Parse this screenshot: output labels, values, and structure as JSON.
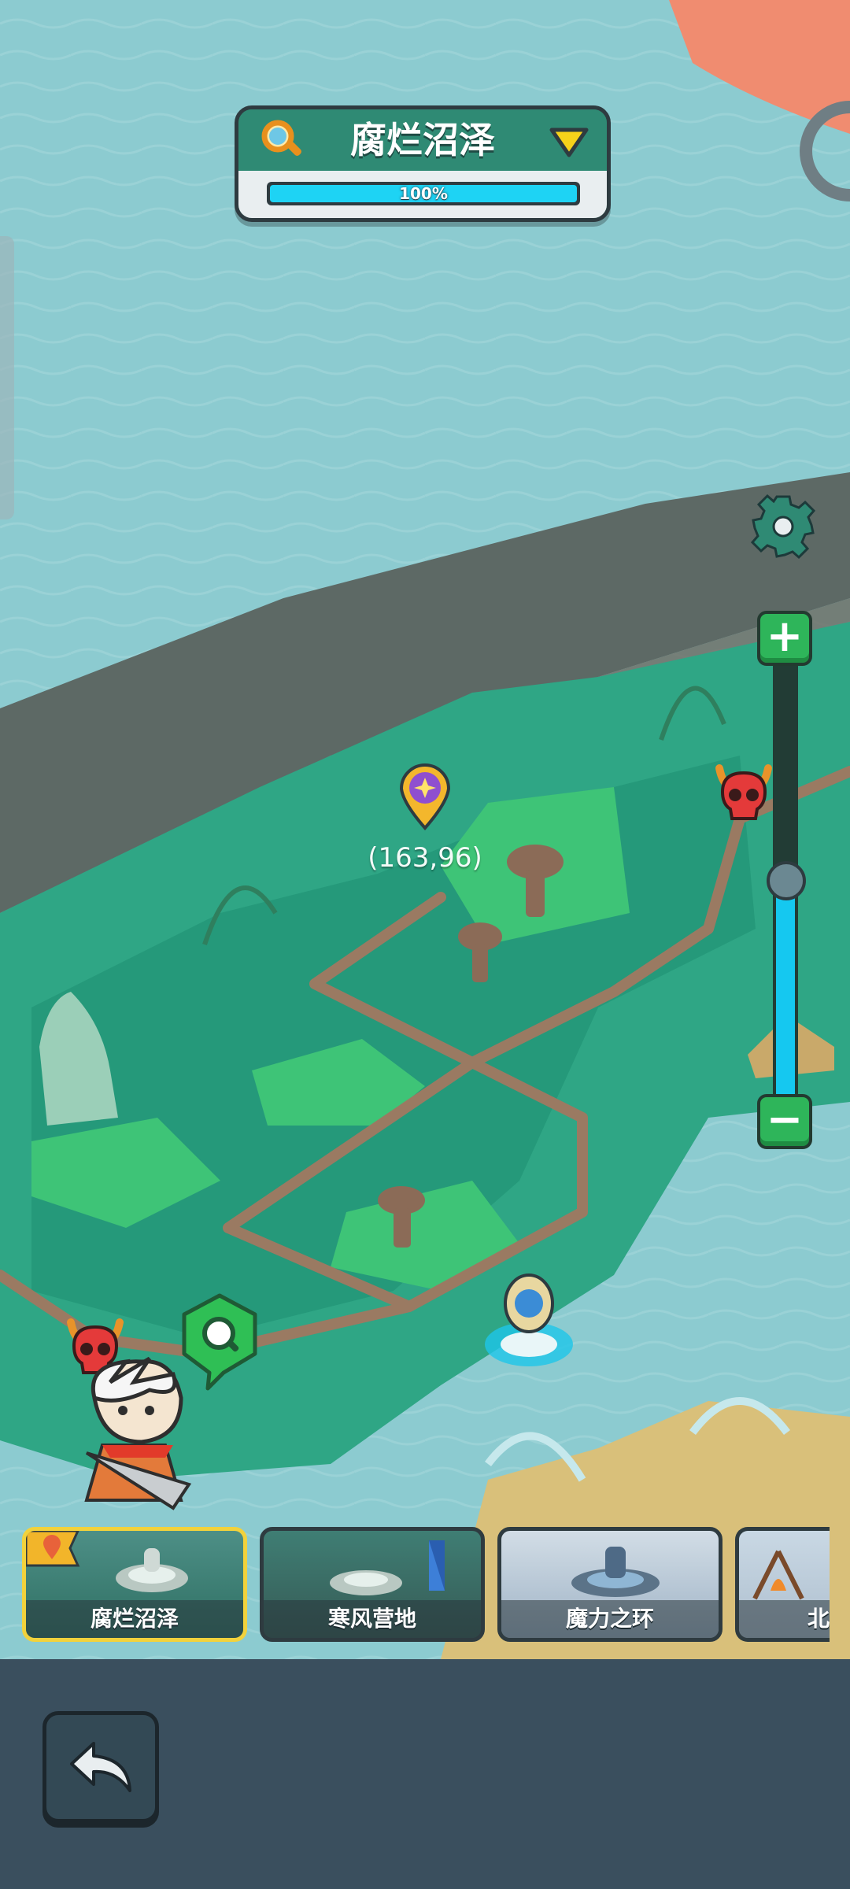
{
  "area": {
    "name": "腐烂沼泽",
    "progress_percent": 100,
    "progress_text": "100%"
  },
  "map": {
    "marker_coords": "(163,96)"
  },
  "zoom": {
    "level_fraction": 0.5
  },
  "regions": [
    {
      "name": "腐烂沼泽",
      "selected": true
    },
    {
      "name": "寒风营地",
      "selected": false
    },
    {
      "name": "魔力之环",
      "selected": false
    },
    {
      "name": "北",
      "selected": false
    }
  ],
  "icons": {
    "search": "magnifier-icon",
    "dropdown": "triangle-down-icon",
    "settings": "gear-icon",
    "zoom_in": "plus-icon",
    "zoom_out": "minus-icon",
    "back": "undo-arrow-icon",
    "enemy": "red-demon-skull-icon",
    "location": "map-pin-icon"
  },
  "colors": {
    "header_green": "#2f8a74",
    "progress_cyan": "#1ed3f4",
    "zoom_green": "#2eb55a",
    "selected_border": "#f2d23c"
  }
}
